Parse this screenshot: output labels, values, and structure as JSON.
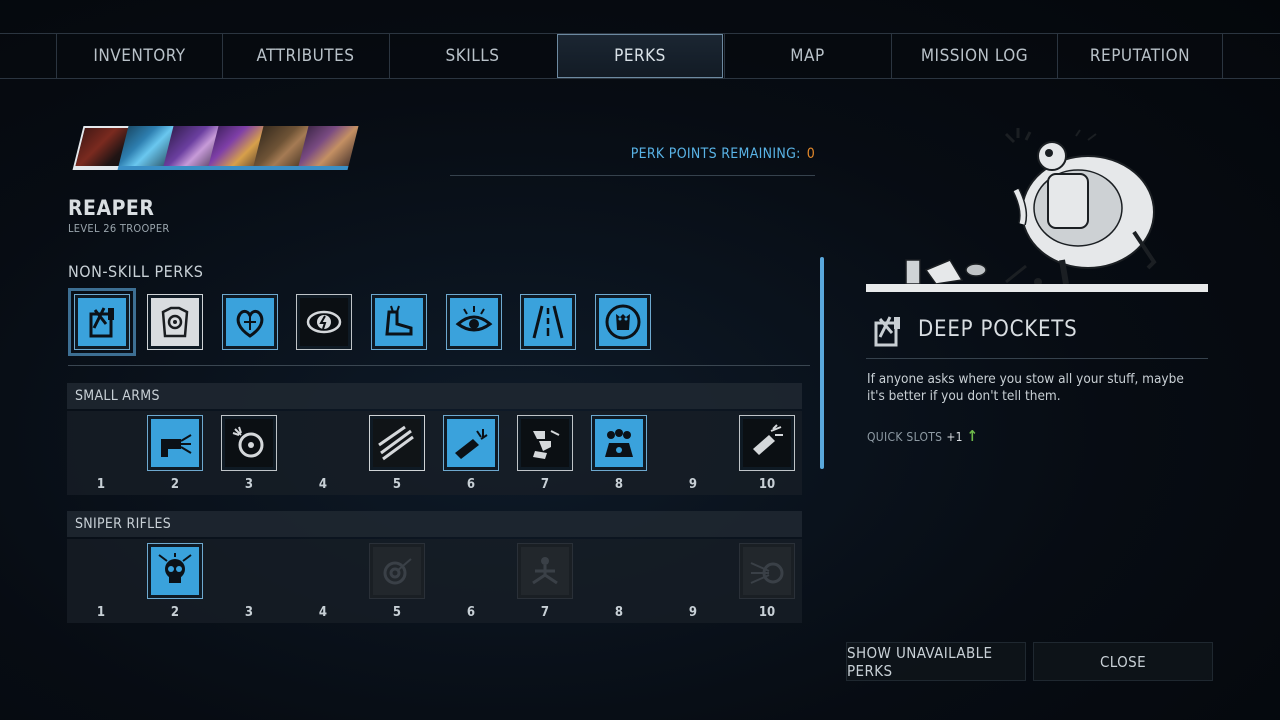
{
  "tabs": [
    {
      "label": "INVENTORY",
      "active": false
    },
    {
      "label": "ATTRIBUTES",
      "active": false
    },
    {
      "label": "SKILLS",
      "active": false
    },
    {
      "label": "PERKS",
      "active": true
    },
    {
      "label": "MAP",
      "active": false
    },
    {
      "label": "MISSION LOG",
      "active": false
    },
    {
      "label": "REPUTATION",
      "active": false
    }
  ],
  "character": {
    "name": "REAPER",
    "subtitle": "LEVEL 26 TROOPER"
  },
  "perk_points": {
    "label": "PERK POINTS REMAINING:",
    "value": "0"
  },
  "non_skill_perks": {
    "title": "NON-SKILL PERKS"
  },
  "groups": [
    {
      "title": "SMALL ARMS",
      "numbers": [
        "1",
        "2",
        "3",
        "4",
        "5",
        "6",
        "7",
        "8",
        "9",
        "10"
      ]
    },
    {
      "title": "SNIPER RIFLES",
      "numbers": [
        "1",
        "2",
        "3",
        "4",
        "5",
        "6",
        "7",
        "8",
        "9",
        "10"
      ]
    }
  ],
  "detail": {
    "title": "DEEP POCKETS",
    "description": "If anyone asks where you stow all your stuff, maybe it's better if you don't tell them.",
    "stat_label": "QUICK SLOTS",
    "stat_value": "+1"
  },
  "buttons": {
    "show_unavailable": "SHOW UNAVAILABLE PERKS",
    "close": "CLOSE"
  },
  "colors": {
    "accent_blue": "#3aa2dc",
    "accent_orange": "#e68a2a",
    "stat_up_green": "#6db84a"
  }
}
